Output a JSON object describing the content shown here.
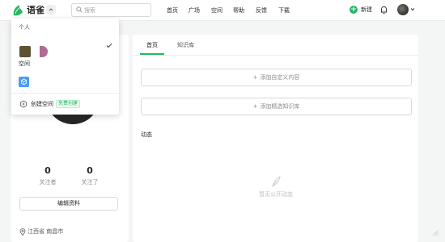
{
  "header": {
    "brand": "语雀",
    "search_placeholder": "搜索",
    "nav": [
      "首页",
      "广场",
      "空间",
      "帮助",
      "反馈",
      "下载"
    ],
    "new_label": "新建"
  },
  "colors": {
    "accent": "#25b864",
    "kb_blue": "#4b9bf5"
  },
  "dropdown": {
    "section_label": "个人",
    "space_label": "空间",
    "create_label": "创建空间",
    "create_badge": "免费创建"
  },
  "profile": {
    "followers_count": "0",
    "followers_label": "关注者",
    "following_count": "0",
    "following_label": "关注了",
    "edit_label": "编辑资料",
    "location": "江西省 南昌市"
  },
  "main": {
    "tabs": [
      "首页",
      "知识库"
    ],
    "active_tab": "首页",
    "add_custom": "添加自定义内容",
    "add_kb": "添加精选知识库",
    "activity_title": "动态",
    "empty_text": "暂无公开动态"
  }
}
